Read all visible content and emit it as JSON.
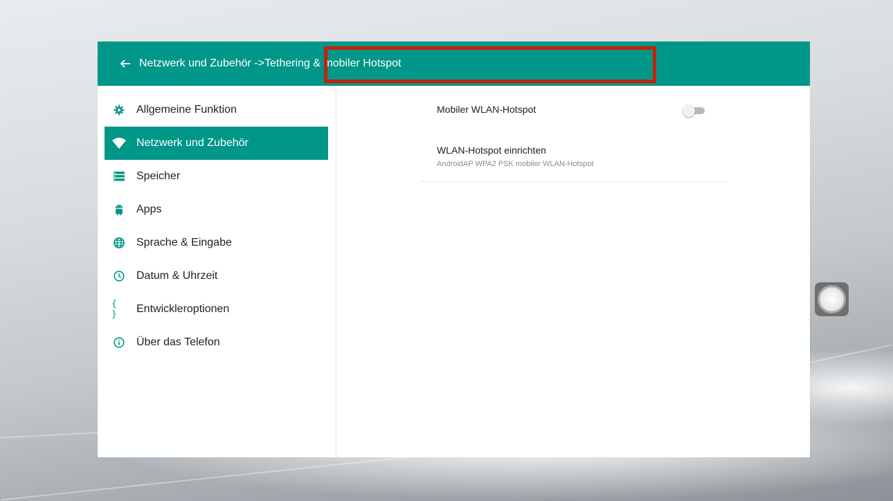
{
  "titlebar": {
    "back_icon": "arrow-left-icon",
    "title": "Netzwerk und Zubehör ->Tethering & mobiler Hotspot"
  },
  "sidebar": {
    "items": [
      {
        "label": "Allgemeine Funktion",
        "icon": "gear-icon",
        "active": false
      },
      {
        "label": "Netzwerk und Zubehör",
        "icon": "wifi-icon",
        "active": true
      },
      {
        "label": "Speicher",
        "icon": "storage-icon",
        "active": false
      },
      {
        "label": "Apps",
        "icon": "android-icon",
        "active": false
      },
      {
        "label": "Sprache & Eingabe",
        "icon": "globe-icon",
        "active": false
      },
      {
        "label": "Datum & Uhrzeit",
        "icon": "clock-icon",
        "active": false
      },
      {
        "label": "Entwickleroptionen",
        "icon": "braces-icon",
        "active": false
      },
      {
        "label": "Über das Telefon",
        "icon": "info-icon",
        "active": false
      }
    ]
  },
  "content": {
    "hotspot": {
      "label": "Mobiler WLAN-Hotspot",
      "enabled": false
    },
    "setup": {
      "title": "WLAN-Hotspot einrichten",
      "subtitle": "AndroidAP WPA2 PSK mobiler WLAN-Hotspot"
    }
  },
  "colors": {
    "accent": "#009688",
    "highlight": "#c8200b"
  },
  "floating_button": {
    "icon": "assistive-touch-icon"
  }
}
